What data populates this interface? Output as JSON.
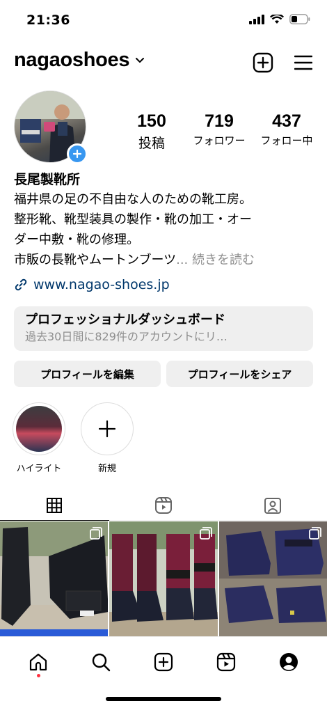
{
  "status": {
    "time": "21:36"
  },
  "header": {
    "username": "nagaoshoes"
  },
  "stats": [
    {
      "value": "150",
      "label": "投稿"
    },
    {
      "value": "719",
      "label": "フォロワー"
    },
    {
      "value": "437",
      "label": "フォロー中"
    }
  ],
  "bio": {
    "name": "長尾製靴所",
    "lines": [
      "福井県の足の不自由な人のための靴工房。",
      "整形靴、靴型装具の製作・靴の加工・オー",
      "ダー中敷・靴の修理。",
      "市販の長靴やムートンブーツ"
    ],
    "ellipsis": "...",
    "more": "続きを読む",
    "link": "www.nagao-shoes.jp"
  },
  "dashboard": {
    "title": "プロフェッショナルダッシュボード",
    "subtitle": "過去30日間に829件のアカウントにリ…"
  },
  "buttons": {
    "edit": "プロフィールを編集",
    "share": "プロフィールをシェア"
  },
  "highlights": [
    {
      "label": "ハイライト"
    },
    {
      "label": "新規"
    }
  ],
  "colors": {
    "link": "#00376b",
    "accent": "#3897f0",
    "notification_dot": "#ff3040"
  }
}
